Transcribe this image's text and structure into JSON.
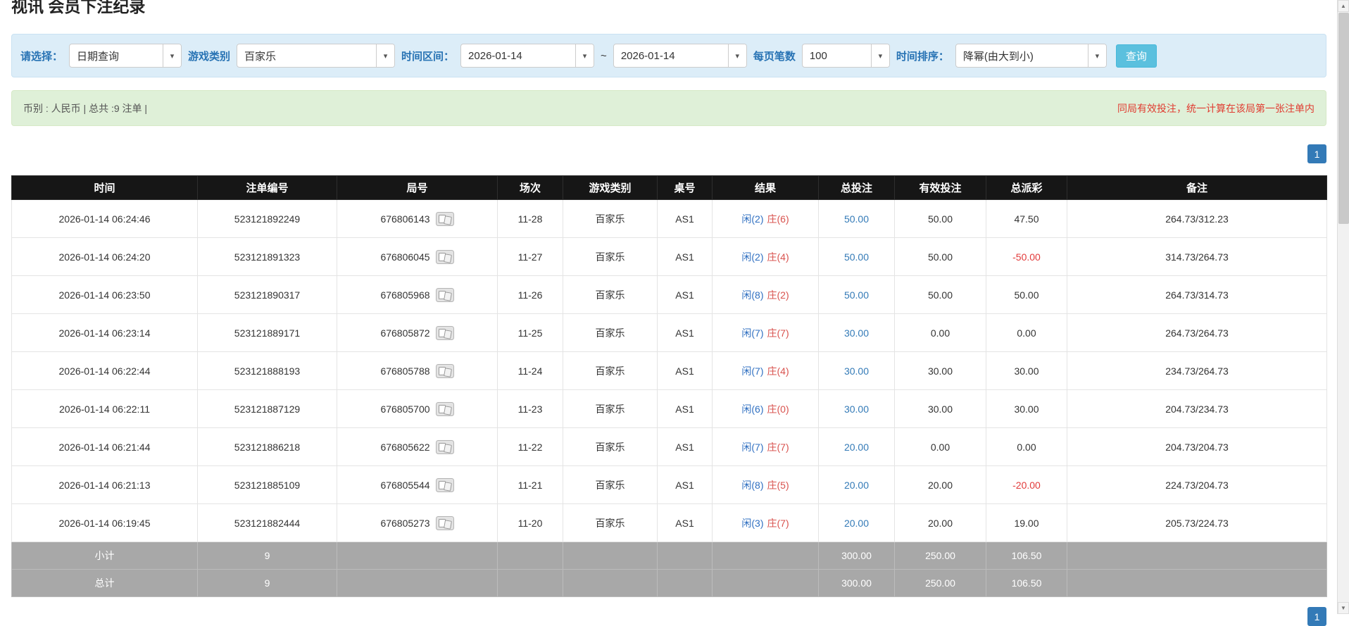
{
  "page": {
    "title": "视讯 会员下注纪录"
  },
  "icons": {
    "chevron_down": "▾",
    "scroll_up": "▲",
    "scroll_down": "▼"
  },
  "filters": {
    "select_label": "请选择：",
    "select_value": "日期查询",
    "game_type_label": "游戏类别",
    "game_type_value": "百家乐",
    "time_range_label": "时间区间：",
    "date_from": "2026-01-14",
    "date_separator": "~",
    "date_to": "2026-01-14",
    "page_size_label": "每页笔数",
    "page_size_value": "100",
    "sort_label": "时间排序：",
    "sort_value": "降幂(由大到小)",
    "search_button": "查询"
  },
  "summary": {
    "left_text": "币别 : 人民币 | 总共 :9 注单 |",
    "right_text": "同局有效投注，统一计算在该局第一张注单内"
  },
  "pagination": {
    "page": "1"
  },
  "table": {
    "headers": [
      "时间",
      "注单编号",
      "局号",
      "场次",
      "游戏类别",
      "桌号",
      "结果",
      "总投注",
      "有效投注",
      "总派彩",
      "备注"
    ],
    "rows": [
      {
        "time": "2026-01-14 06:24:46",
        "bet_id": "523121892249",
        "round_id": "676806143",
        "session": "11-28",
        "game": "百家乐",
        "table_no": "AS1",
        "result_player": "闲(2)",
        "result_banker": "庄(6)",
        "total_bet": "50.00",
        "valid_bet": "50.00",
        "payout": "47.50",
        "note": "264.73/312.23"
      },
      {
        "time": "2026-01-14 06:24:20",
        "bet_id": "523121891323",
        "round_id": "676806045",
        "session": "11-27",
        "game": "百家乐",
        "table_no": "AS1",
        "result_player": "闲(2)",
        "result_banker": "庄(4)",
        "total_bet": "50.00",
        "valid_bet": "50.00",
        "payout": "-50.00",
        "note": "314.73/264.73"
      },
      {
        "time": "2026-01-14 06:23:50",
        "bet_id": "523121890317",
        "round_id": "676805968",
        "session": "11-26",
        "game": "百家乐",
        "table_no": "AS1",
        "result_player": "闲(8)",
        "result_banker": "庄(2)",
        "total_bet": "50.00",
        "valid_bet": "50.00",
        "payout": "50.00",
        "note": "264.73/314.73"
      },
      {
        "time": "2026-01-14 06:23:14",
        "bet_id": "523121889171",
        "round_id": "676805872",
        "session": "11-25",
        "game": "百家乐",
        "table_no": "AS1",
        "result_player": "闲(7)",
        "result_banker": "庄(7)",
        "total_bet": "30.00",
        "valid_bet": "0.00",
        "payout": "0.00",
        "note": "264.73/264.73"
      },
      {
        "time": "2026-01-14 06:22:44",
        "bet_id": "523121888193",
        "round_id": "676805788",
        "session": "11-24",
        "game": "百家乐",
        "table_no": "AS1",
        "result_player": "闲(7)",
        "result_banker": "庄(4)",
        "total_bet": "30.00",
        "valid_bet": "30.00",
        "payout": "30.00",
        "note": "234.73/264.73"
      },
      {
        "time": "2026-01-14 06:22:11",
        "bet_id": "523121887129",
        "round_id": "676805700",
        "session": "11-23",
        "game": "百家乐",
        "table_no": "AS1",
        "result_player": "闲(6)",
        "result_banker": "庄(0)",
        "total_bet": "30.00",
        "valid_bet": "30.00",
        "payout": "30.00",
        "note": "204.73/234.73"
      },
      {
        "time": "2026-01-14 06:21:44",
        "bet_id": "523121886218",
        "round_id": "676805622",
        "session": "11-22",
        "game": "百家乐",
        "table_no": "AS1",
        "result_player": "闲(7)",
        "result_banker": "庄(7)",
        "total_bet": "20.00",
        "valid_bet": "0.00",
        "payout": "0.00",
        "note": "204.73/204.73"
      },
      {
        "time": "2026-01-14 06:21:13",
        "bet_id": "523121885109",
        "round_id": "676805544",
        "session": "11-21",
        "game": "百家乐",
        "table_no": "AS1",
        "result_player": "闲(8)",
        "result_banker": "庄(5)",
        "total_bet": "20.00",
        "valid_bet": "20.00",
        "payout": "-20.00",
        "note": "224.73/204.73"
      },
      {
        "time": "2026-01-14 06:19:45",
        "bet_id": "523121882444",
        "round_id": "676805273",
        "session": "11-20",
        "game": "百家乐",
        "table_no": "AS1",
        "result_player": "闲(3)",
        "result_banker": "庄(7)",
        "total_bet": "20.00",
        "valid_bet": "20.00",
        "payout": "19.00",
        "note": "205.73/224.73"
      }
    ],
    "subtotal": {
      "label": "小计",
      "count": "9",
      "total_bet": "300.00",
      "valid_bet": "250.00",
      "payout": "106.50"
    },
    "total": {
      "label": "总计",
      "count": "9",
      "total_bet": "300.00",
      "valid_bet": "250.00",
      "payout": "106.50"
    }
  }
}
